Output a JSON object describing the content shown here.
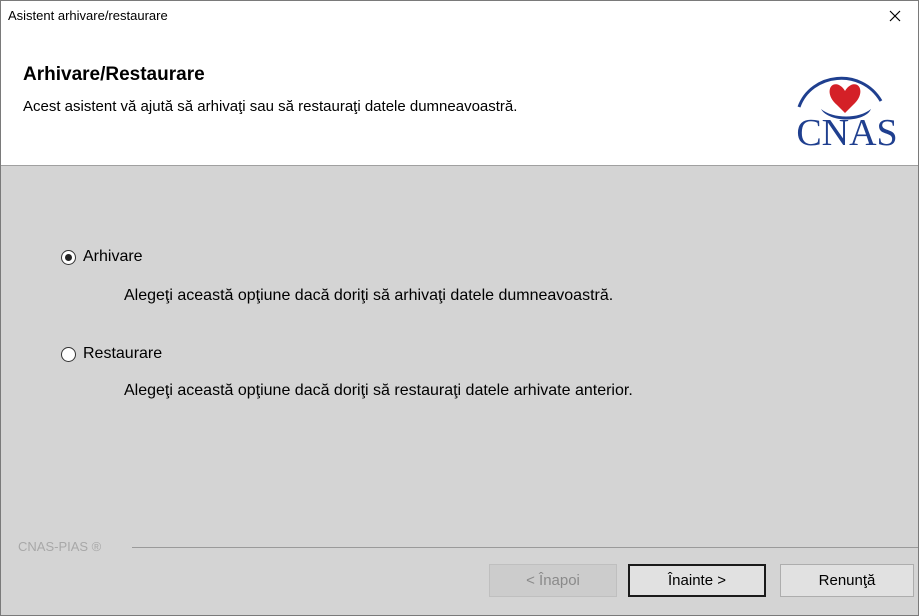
{
  "window": {
    "title": "Asistent arhivare/restaurare"
  },
  "header": {
    "title": "Arhivare/Restaurare",
    "subtitle": "Acest asistent vă ajută să arhivaţi sau să restauraţi datele dumneavoastră.",
    "logo_text": "CNAS"
  },
  "options": [
    {
      "label": "Arhivare",
      "description": "Alegeţi această opţiune dacă doriţi să arhivaţi datele dumneavoastră.",
      "checked": true
    },
    {
      "label": "Restaurare",
      "description": "Alegeţi această opţiune dacă doriţi să restauraţi datele arhivate anterior.",
      "checked": false
    }
  ],
  "footer": {
    "brand": "CNAS-PIAS ®"
  },
  "buttons": {
    "back": "< Înapoi",
    "next": "Înainte >",
    "cancel": "Renunţă"
  },
  "colors": {
    "body_background": "#d4d4d4",
    "logo_blue": "#1f3f8f",
    "logo_red": "#d42027"
  }
}
